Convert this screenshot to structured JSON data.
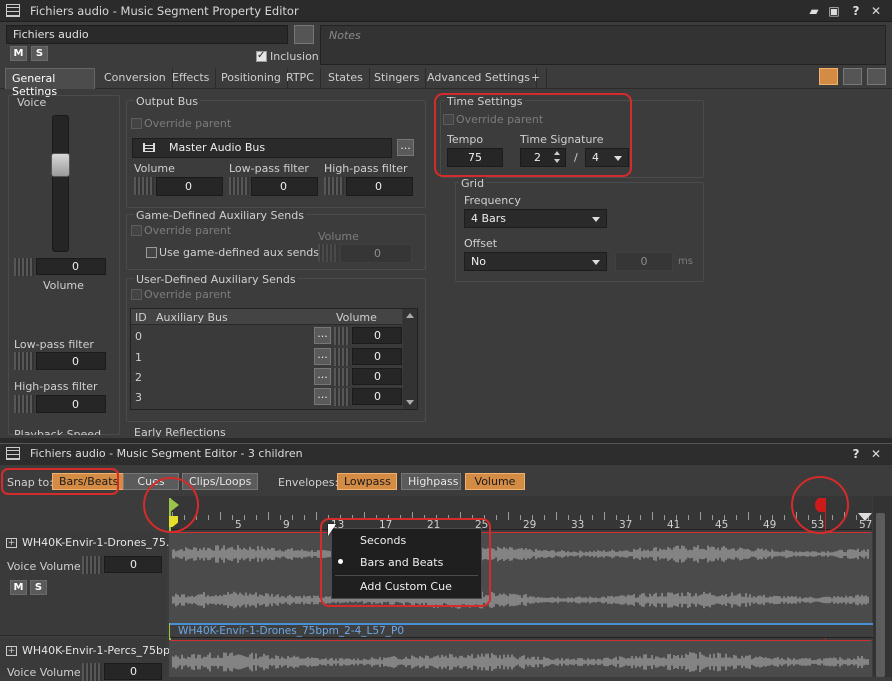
{
  "window": {
    "title": "Fichiers audio - Music Segment Property Editor"
  },
  "name_field": "Fichiers audio",
  "notes_placeholder": "Notes",
  "mute_label": "M",
  "solo_label": "S",
  "inclusion_label": "Inclusion",
  "tabs": [
    "General Settings",
    "Conversion",
    "Effects",
    "Positioning",
    "RTPC",
    "States",
    "Stingers",
    "Advanced Settings",
    "+"
  ],
  "voice": {
    "title": "Voice",
    "volume_value": "0",
    "volume_label": "Volume",
    "lowpass_label": "Low-pass filter",
    "lowpass_value": "0",
    "highpass_label": "High-pass filter",
    "highpass_value": "0",
    "playback_cut": "Playback Speed"
  },
  "output_bus": {
    "title": "Output Bus",
    "override": "Override parent",
    "bus_name": "Master Audio Bus",
    "ellipsis": "...",
    "volume_label": "Volume",
    "volume_value": "0",
    "lowpass_label": "Low-pass filter",
    "lowpass_value": "0",
    "highpass_label": "High-pass filter",
    "highpass_value": "0"
  },
  "game_aux": {
    "title": "Game-Defined Auxiliary Sends",
    "override": "Override parent",
    "use_label": "Use game-defined aux sends",
    "volume_label": "Volume",
    "volume_value": "0"
  },
  "user_aux": {
    "title": "User-Defined Auxiliary Sends",
    "override": "Override parent",
    "col_id": "ID",
    "col_bus": "Auxiliary Bus",
    "col_volume": "Volume",
    "rows": [
      {
        "id": "0",
        "volume": "0"
      },
      {
        "id": "1",
        "volume": "0"
      },
      {
        "id": "2",
        "volume": "0"
      },
      {
        "id": "3",
        "volume": "0"
      }
    ]
  },
  "early_reflections": "Early Reflections",
  "time_settings": {
    "title": "Time Settings",
    "override": "Override parent",
    "tempo_label": "Tempo",
    "tempo_value": "75",
    "sig_label": "Time Signature",
    "sig_num": "2",
    "slash": "/",
    "sig_den": "4"
  },
  "grid": {
    "title": "Grid",
    "frequency_label": "Frequency",
    "frequency_value": "4 Bars",
    "offset_label": "Offset",
    "offset_value": "No",
    "offset_ms": "0",
    "ms_unit": "ms"
  },
  "segment_editor": {
    "title": "Fichiers audio - Music Segment Editor - 3 children",
    "snap_label": "Snap to:",
    "snap_buttons": [
      "Bars/Beats",
      "Cues",
      "Clips/Loops"
    ],
    "envelopes_label": "Envelopes:",
    "envelope_buttons": [
      "Lowpass",
      "Highpass",
      "Volume"
    ],
    "ruler_ticks": [
      "5",
      "9",
      "13",
      "17",
      "21",
      "25",
      "29",
      "33",
      "37",
      "41",
      "45",
      "49",
      "53",
      "57"
    ],
    "tracks": [
      {
        "name": "WH40K-Envir-1-Drones_75...",
        "voice_volume_label": "Voice Volume",
        "voice_volume": "0",
        "clip_label": "WH40K-Envir-1-Drones_75bpm_2-4_L57_P0"
      },
      {
        "name": "WH40K-Envir-1-Percs_75bp...",
        "voice_volume_label": "Voice Volume",
        "voice_volume": "0"
      }
    ],
    "context_menu": [
      {
        "label": "Seconds",
        "selected": false
      },
      {
        "label": "Bars and Beats",
        "selected": true
      },
      {
        "label": "Add Custom Cue",
        "selected": false
      }
    ]
  },
  "colors": {
    "accent": "#d48c45",
    "annotation_red": "#d62b2b",
    "clip_blue": "#4a90d9"
  }
}
